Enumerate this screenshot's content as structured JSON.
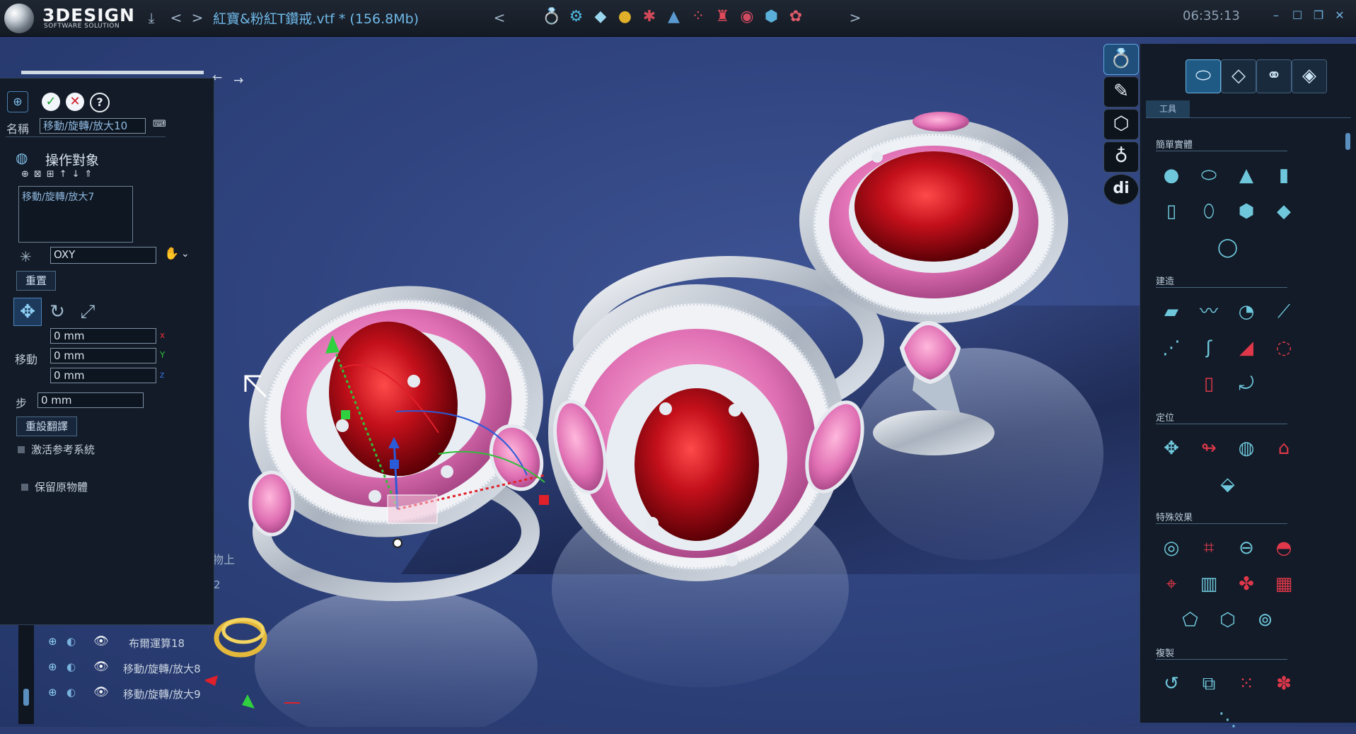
{
  "app": {
    "logo": "3DESIGN",
    "logo_sub": "SOFTWARE SOLUTION",
    "document_title": "紅寶&粉紅T鑽戒.vtf * (156.8Mb)",
    "clock": "06:35:13"
  },
  "titlebar": {
    "icons": [
      "save-icon",
      "back-arrow-icon",
      "forward-arrow-icon",
      "prev-icon",
      "next-icon"
    ],
    "gem_tools": [
      {
        "name": "ring-tool-icon",
        "glyph": "💍",
        "color": "#e03a3a"
      },
      {
        "name": "bezel-tool-icon",
        "glyph": "⚙",
        "color": "#4fb8e0"
      },
      {
        "name": "diamond-tool-icon",
        "glyph": "◆",
        "color": "#9ad6ee"
      },
      {
        "name": "color-gem-icon",
        "glyph": "●",
        "color": "#e0b02a"
      },
      {
        "name": "prong-tool-icon",
        "glyph": "✱",
        "color": "#d24a5a"
      },
      {
        "name": "drop-gem-icon",
        "glyph": "▲",
        "color": "#5a9ad0"
      },
      {
        "name": "pave-tool-icon",
        "glyph": "⁘",
        "color": "#e05060"
      },
      {
        "name": "head-tool-icon",
        "glyph": "♜",
        "color": "#e04a5a"
      },
      {
        "name": "channel-tool-icon",
        "glyph": "◉",
        "color": "#d04a60"
      },
      {
        "name": "cluster-gem-icon",
        "glyph": "⬢",
        "color": "#5ab0d8"
      },
      {
        "name": "halo-tool-icon",
        "glyph": "✿",
        "color": "#e05a6a"
      }
    ],
    "window_controls": [
      "minimize-icon",
      "maximize-icon",
      "restore-icon",
      "close-icon"
    ]
  },
  "left_panel": {
    "name_label": "名稱",
    "name_value": "移動/旋轉/放大10",
    "objects_header": "操作對象",
    "objects_list": [
      "移動/旋轉/放大7"
    ],
    "plane_value": "OXY",
    "reset_label": "重置",
    "move_label": "移動",
    "move_x": "0 mm",
    "move_y": "0 mm",
    "move_z": "0 mm",
    "axis_x": "x",
    "axis_y": "Y",
    "axis_z": "z",
    "step_label": "步",
    "step_value": "0 mm",
    "reset_flip_label": "重設翻譯",
    "activate_ref_label": "激活参考系統",
    "keep_original_label": "保留原物體"
  },
  "viewport": {
    "behind_text_1": "物上",
    "behind_text_2": "2"
  },
  "tree": {
    "rows": [
      {
        "label": "布爾運算18"
      },
      {
        "label": "移動/旋轉/放大8"
      },
      {
        "label": "移動/旋轉/放大9"
      }
    ]
  },
  "right_panel": {
    "tool_tab": "工具",
    "sections": [
      {
        "title": "簡單實體",
        "icons": [
          "sphere-icon",
          "torus-icon",
          "cone-icon",
          "cylinder-icon",
          "tube-icon",
          "capsule-icon",
          "cube-icon",
          "pyramid-icon",
          "ring-primitive-icon"
        ]
      },
      {
        "title": "建造",
        "icons": [
          "extrude-icon",
          "sweep-icon",
          "revolve-icon",
          "rail-icon",
          "array-curve-icon",
          "loft-icon",
          "surface-icon",
          "patch-icon",
          "pipe-icon",
          "bend-icon"
        ]
      },
      {
        "title": "定位",
        "icons": [
          "move-rotate-icon",
          "align-icon",
          "place-on-icon",
          "snap-icon",
          "drop-icon"
        ]
      },
      {
        "title": "特殊效果",
        "icons": [
          "boolean-icon",
          "cut-icon",
          "intersect-icon",
          "shell-icon",
          "deform-icon",
          "split-icon",
          "merge-color-icon",
          "texture-icon",
          "wire-icon",
          "polygon-icon",
          "link-icon"
        ]
      },
      {
        "title": "複製",
        "icons": [
          "copy-circular-icon",
          "copy-mirror-icon",
          "copy-grid-icon",
          "copy-radial-icon",
          "copy-path-icon"
        ]
      }
    ]
  }
}
